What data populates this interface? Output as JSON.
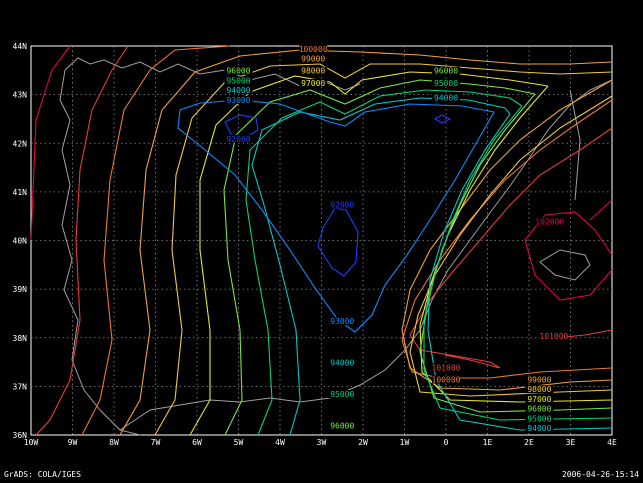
{
  "footer": {
    "left_text": "GrADS: COLA/IGES",
    "right_text": "2006-04-26-15:14"
  },
  "map": {
    "lon_labels": [
      "10W",
      "9W",
      "8W",
      "7W",
      "6W",
      "5W",
      "4W",
      "3W",
      "2W",
      "1W",
      "0",
      "1E",
      "2E",
      "3E",
      "4E"
    ],
    "lat_labels": [
      "36N",
      "37N",
      "38N",
      "39N",
      "40N",
      "41N",
      "42N",
      "43N",
      "44N"
    ],
    "lon_range": [
      -10,
      4
    ],
    "lat_range": [
      36,
      44
    ],
    "grid": "dotted",
    "colors": {
      "c92000": "#1e3cff",
      "c93000": "#0a8cff",
      "c94000": "#00c8c8",
      "c95000": "#00d278",
      "c96000": "#78e63c",
      "c97000": "#e6e632",
      "c98000": "#f0c83c",
      "c99000": "#f0a03c",
      "c100000": "#eb7832",
      "c101000": "#e63c3c",
      "c102000": "#e6004b",
      "coast": "#a0a0a0"
    },
    "contour_labels": [
      {
        "text": "100000",
        "lon": -3.2,
        "lat": 43.9,
        "level": "c100000"
      },
      {
        "text": "99000",
        "lon": -3.2,
        "lat": 43.7,
        "level": "c99000"
      },
      {
        "text": "98000",
        "lon": -3.2,
        "lat": 43.45,
        "level": "c98000"
      },
      {
        "text": "97000",
        "lon": -3.2,
        "lat": 43.2,
        "level": "c97000"
      },
      {
        "text": "96000",
        "lon": -5.0,
        "lat": 43.45,
        "level": "c96000"
      },
      {
        "text": "95000",
        "lon": -5.0,
        "lat": 43.25,
        "level": "c95000"
      },
      {
        "text": "94000",
        "lon": -5.0,
        "lat": 43.05,
        "level": "c94000"
      },
      {
        "text": "93000",
        "lon": -5.0,
        "lat": 42.85,
        "level": "c93000"
      },
      {
        "text": "92000",
        "lon": -5.0,
        "lat": 42.05,
        "level": "c92000"
      },
      {
        "text": "92000",
        "lon": -2.5,
        "lat": 40.7,
        "level": "c92000"
      },
      {
        "text": "93000",
        "lon": -2.5,
        "lat": 38.3,
        "level": "c93000"
      },
      {
        "text": "94000",
        "lon": -2.5,
        "lat": 37.45,
        "level": "c94000"
      },
      {
        "text": "95000",
        "lon": -2.5,
        "lat": 36.8,
        "level": "c95000"
      },
      {
        "text": "96000",
        "lon": -2.5,
        "lat": 36.15,
        "level": "c96000"
      },
      {
        "text": "96000",
        "lon": 0.0,
        "lat": 43.45,
        "level": "c96000"
      },
      {
        "text": "95000",
        "lon": 0.0,
        "lat": 43.2,
        "level": "c95000"
      },
      {
        "text": "94000",
        "lon": 0.0,
        "lat": 42.9,
        "level": "c94000"
      },
      {
        "text": "102000",
        "lon": 2.5,
        "lat": 40.35,
        "level": "c102000"
      },
      {
        "text": "101000",
        "lon": 2.6,
        "lat": 38.0,
        "level": "c101000"
      },
      {
        "text": "101000",
        "lon": 0.0,
        "lat": 37.35,
        "level": "c101000"
      },
      {
        "text": "100000",
        "lon": 0.0,
        "lat": 37.1,
        "level": "c100000"
      },
      {
        "text": "99000",
        "lon": 2.25,
        "lat": 37.1,
        "level": "c99000"
      },
      {
        "text": "98000",
        "lon": 2.25,
        "lat": 36.9,
        "level": "c98000"
      },
      {
        "text": "97000",
        "lon": 2.25,
        "lat": 36.7,
        "level": "c97000"
      },
      {
        "text": "96000",
        "lon": 2.25,
        "lat": 36.5,
        "level": "c96000"
      },
      {
        "text": "95000",
        "lon": 2.25,
        "lat": 36.3,
        "level": "c95000"
      },
      {
        "text": "94000",
        "lon": 2.25,
        "lat": 36.1,
        "level": "c94000"
      }
    ]
  }
}
